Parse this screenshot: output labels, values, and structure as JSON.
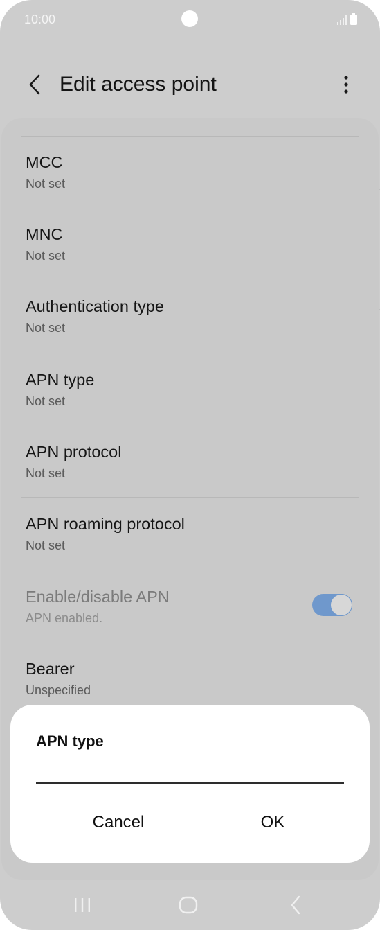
{
  "status_bar": {
    "time": "10:00"
  },
  "header": {
    "title": "Edit access point"
  },
  "settings": [
    {
      "title": "MCC",
      "value": "Not set"
    },
    {
      "title": "MNC",
      "value": "Not set"
    },
    {
      "title": "Authentication type",
      "value": "Not set"
    },
    {
      "title": "APN type",
      "value": "Not set"
    },
    {
      "title": "APN protocol",
      "value": "Not set"
    },
    {
      "title": "APN roaming protocol",
      "value": "Not set"
    },
    {
      "title": "Enable/disable APN",
      "value": "APN enabled.",
      "toggle_on": true,
      "disabled": true
    },
    {
      "title": "Bearer",
      "value": "Unspecified"
    }
  ],
  "dialog": {
    "title": "APN type",
    "input_value": "",
    "cancel_label": "Cancel",
    "ok_label": "OK"
  },
  "colors": {
    "background": "#cdcdcd",
    "toggle_accent": "#6f98cc",
    "dialog_bg": "#ffffff"
  }
}
